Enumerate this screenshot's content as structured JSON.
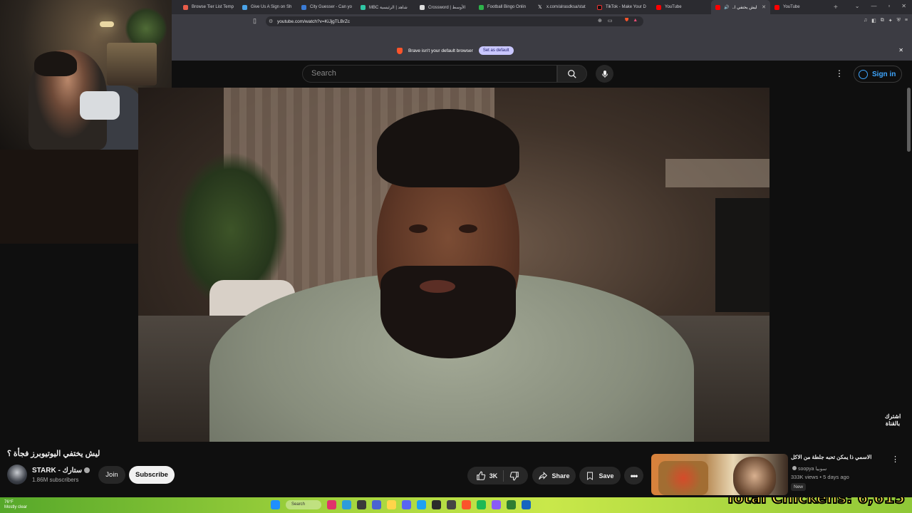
{
  "browser": {
    "tabs": [
      {
        "label": "Browse Tier List Temp",
        "color": "#e85d4a"
      },
      {
        "label": "Give Us A Sign on Sh",
        "color": "#4aa3e8"
      },
      {
        "label": "City Guesser - Can yo",
        "color": "#3a7bd5"
      },
      {
        "label": "MBC شاهد | الرئيسية",
        "color": "#2fc6a4"
      },
      {
        "label": "Crossword | الأوسط",
        "color": "#dddddd"
      },
      {
        "label": "Football Bingo Onlin",
        "color": "#2db34a"
      },
      {
        "label": "x.com/alrasdksa/stat",
        "color": "#ffffff"
      },
      {
        "label": "TikTok - Make Your D",
        "color": "#111111"
      },
      {
        "label": "YouTube",
        "color": "#ff0000"
      },
      {
        "label": "ليش يختفي ا..",
        "color": "#ff0000"
      },
      {
        "label": "YouTube",
        "color": "#ff0000"
      }
    ],
    "active_tab_index": 9,
    "url": "youtube.com/watch?v=KiJjgTLBrZc",
    "infobar_message": "Brave isn't your default browser",
    "set_default_label": "Set as default"
  },
  "youtube": {
    "search_placeholder": "Search",
    "signin_label": "Sign in",
    "video_title": "ليش يختفي اليوتيوبرز فجأة ؟",
    "channel_name": "STARK - ستارك",
    "subscribers": "1.86M subscribers",
    "join_label": "Join",
    "subscribe_label": "Subscribe",
    "likes": "3K",
    "share_label": "Share",
    "save_label": "Save",
    "watermark": "اشترك بالقناة",
    "recommended": {
      "title": "الاسمي ذا يمكن تحبه جلطة من الاكل",
      "channel": "soopya سوبيا",
      "meta": "333K views • 5 days ago",
      "badge": "New"
    }
  },
  "stream_overlay": {
    "counter_text": "Total Chickens: 6,615"
  },
  "taskbar": {
    "weather": "76°F\nMostly clear",
    "search_label": "Search"
  }
}
